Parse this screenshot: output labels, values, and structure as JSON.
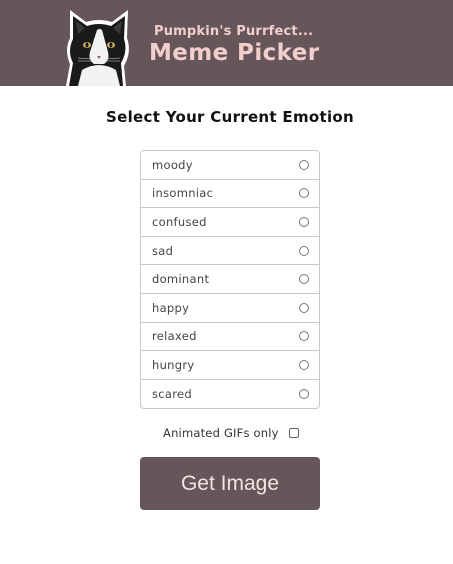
{
  "header": {
    "subtitle": "Pumpkin's Purrfect...",
    "title": "Meme Picker",
    "background_color": "#665559",
    "text_color": "#f0cfcc",
    "logo_icon": "cat-photo-icon"
  },
  "main": {
    "heading": "Select Your Current Emotion",
    "emotions": [
      {
        "label": "moody"
      },
      {
        "label": "insomniac"
      },
      {
        "label": "confused"
      },
      {
        "label": "sad"
      },
      {
        "label": "dominant"
      },
      {
        "label": "happy"
      },
      {
        "label": "relaxed"
      },
      {
        "label": "hungry"
      },
      {
        "label": "scared"
      }
    ],
    "gif_toggle_label": "Animated GIFs only",
    "get_button_label": "Get Image",
    "button_color": "#665559"
  }
}
